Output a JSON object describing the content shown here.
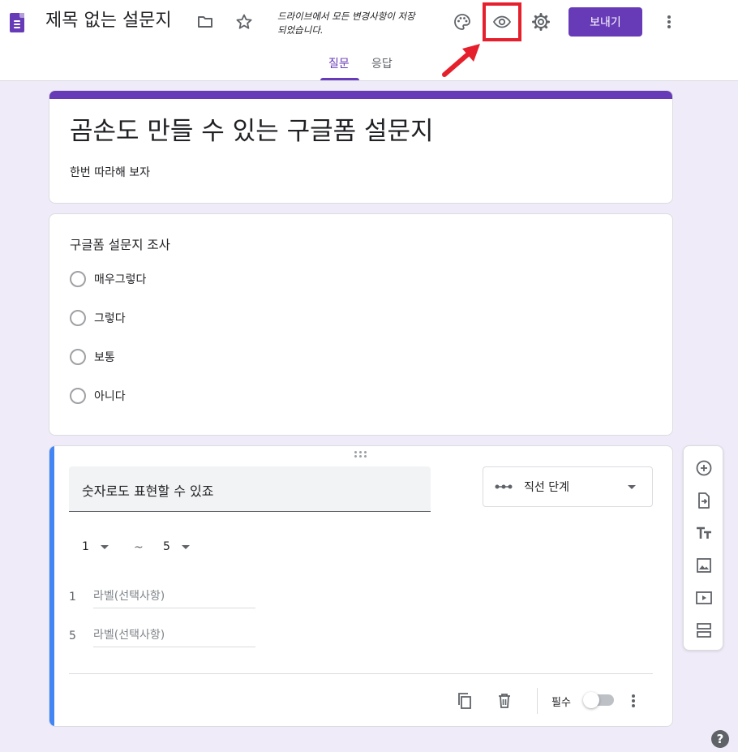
{
  "header": {
    "doc_title": "제목 없는 설문지",
    "save_status": "드라이브에서 모든 변경사항이 저장되었습니다.",
    "send_label": "보내기",
    "tabs": [
      {
        "label": "질문",
        "active": true
      },
      {
        "label": "응답",
        "active": false
      }
    ]
  },
  "title_card": {
    "title": "곰손도 만들 수 있는 구글폼 설문지",
    "description": "한번 따라해 보자"
  },
  "question1": {
    "title": "구글폼 설문지 조사",
    "options": [
      "매우그렇다",
      "그렇다",
      "보통",
      "아니다"
    ]
  },
  "question2": {
    "title": "숫자로도 표현할 수 있죠",
    "type_label": "직선 단계",
    "scale_min": "1",
    "scale_tilde": "~",
    "scale_max": "5",
    "labels": [
      {
        "num": "1",
        "placeholder": "라벨(선택사항)"
      },
      {
        "num": "5",
        "placeholder": "라벨(선택사항)"
      }
    ],
    "required_label": "필수",
    "required": false
  },
  "help": "?",
  "colors": {
    "accent": "#673ab7",
    "active_card": "#4285f4",
    "background": "#f0ebf8",
    "annotation": "#e5202c"
  },
  "icons": [
    "forms-app-icon",
    "folder-icon",
    "star-icon",
    "palette-icon",
    "eye-preview-icon",
    "settings-gear-icon",
    "more-vert-icon",
    "drag-handle-icon",
    "linear-scale-icon",
    "copy-icon",
    "trash-icon",
    "add-circle-icon",
    "import-icon",
    "title-text-icon",
    "image-icon",
    "video-icon",
    "section-icon",
    "help-icon"
  ]
}
